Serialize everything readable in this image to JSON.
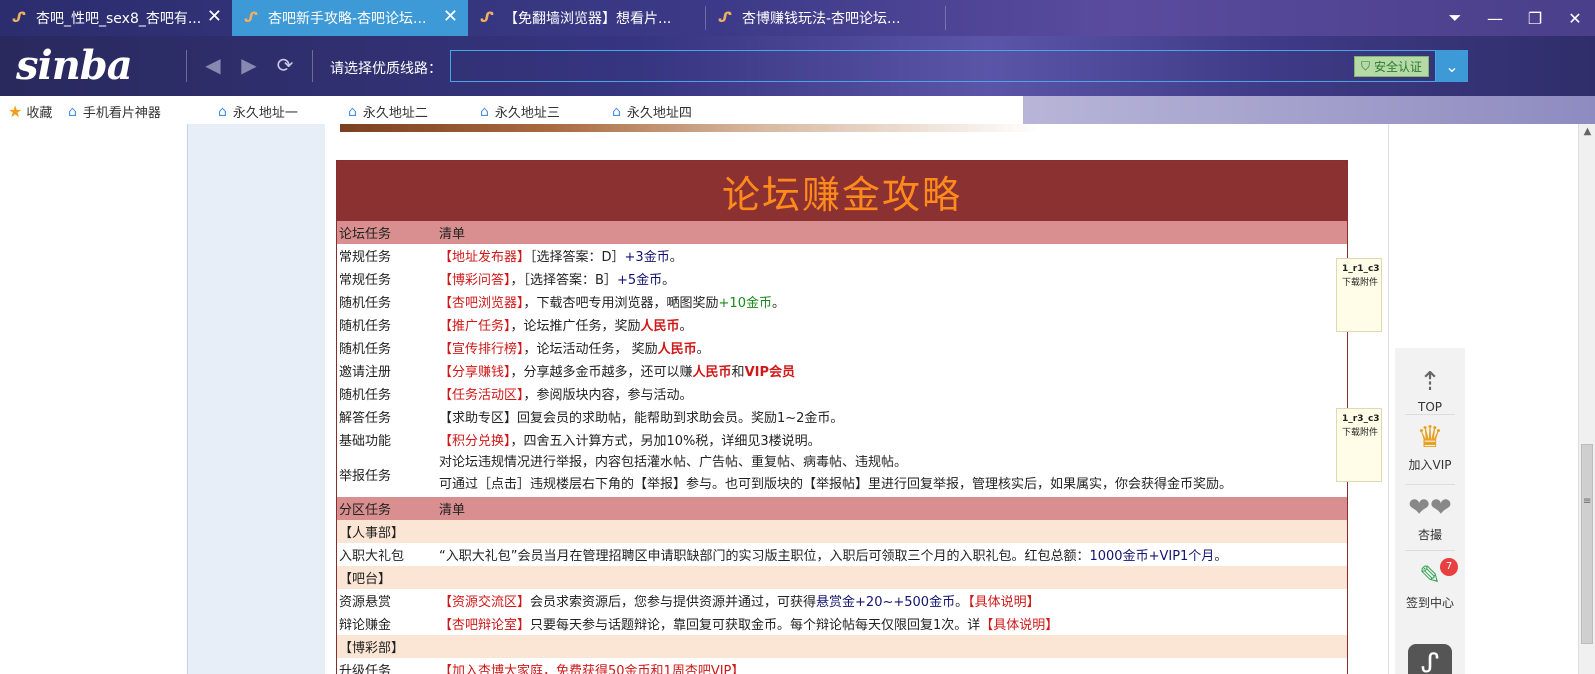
{
  "tabs": [
    {
      "title": "杏吧_性吧_sex8_杏吧有...",
      "close": "✕"
    },
    {
      "title": "杏吧新手攻略-杏吧论坛...",
      "close": "✕"
    },
    {
      "title": "【免翻墙浏览器】想看片...",
      "close": ""
    },
    {
      "title": "杏博赚钱玩法-杏吧论坛...",
      "close": ""
    }
  ],
  "window_controls": {
    "dropdown": "⏷",
    "minimize": "—",
    "maximize": "❐",
    "close": "✕"
  },
  "nav": {
    "logo": "sinba",
    "back": "◀",
    "forward": "▶",
    "refresh": "⟳",
    "route_label": "请选择优质线路：",
    "url_value": "",
    "safe_badge": "安全认证",
    "url_dropdown": "⌄"
  },
  "bookmarks": [
    {
      "label": "收藏"
    },
    {
      "label": "手机看片神器"
    },
    {
      "label": "永久地址一"
    },
    {
      "label": "永久地址二"
    },
    {
      "label": "永久地址三"
    },
    {
      "label": "永久地址四"
    }
  ],
  "table": {
    "title": "论坛赚金攻略",
    "header1": {
      "c1": "论坛任务",
      "c2": "清单"
    },
    "rows": [
      {
        "c1": "常规任务",
        "a": "【地址发布器】",
        "b": "［选择答案：D］",
        "c": "+3金币",
        "d": "。"
      },
      {
        "c1": "常规任务",
        "a": "【博彩问答】",
        "b": "，［选择答案：B］",
        "c": "+5金币",
        "d": "。"
      },
      {
        "c1": "随机任务",
        "a": "【杏吧浏览器】",
        "b": "，下载杏吧专用浏览器，嗮图奖励",
        "c": "+10金币",
        "d": "。"
      },
      {
        "c1": "随机任务",
        "a": "【推广任务】",
        "b": "，论坛推广任务，奖励",
        "c": "人民币",
        "d": "。"
      },
      {
        "c1": "随机任务",
        "a": "【宣传排行榜】",
        "b": "，论坛活动任务， 奖励",
        "c": "人民币",
        "d": "。"
      },
      {
        "c1": "邀请注册",
        "a": "【分享赚钱】",
        "b": "，分享越多金币越多，还可以赚",
        "c": "人民币",
        "d": "和",
        "e": "VIP会员"
      },
      {
        "c1": "随机任务",
        "a": "【任务活动区】",
        "b": "，参阅版块内容，参与活动。",
        "c": "",
        "d": ""
      },
      {
        "c1": "解答任务",
        "a": "",
        "b": "【求助专区】回复会员的求助帖，能帮助到求助会员。奖励1~2金币。",
        "c": "",
        "d": ""
      },
      {
        "c1": "基础功能",
        "a": "【积分兑换】",
        "b": "，四舍五入计算方式，另加10%税，详细见3楼说明。",
        "c": "",
        "d": ""
      }
    ],
    "report": {
      "c1": "举报任务",
      "line1": "对论坛违规情况进行举报，内容包括灌水帖、广告帖、重复帖、病毒帖、违规帖。",
      "line2": "可通过［点击］违规楼层右下角的【举报】参与。也可到版块的【举报帖】里进行回复举报，管理核实后，如果属实，你会获得金币奖励。"
    },
    "header2": {
      "c1": "分区任务",
      "c2": "清单"
    },
    "sec1": "【人事部】",
    "hr_row": {
      "c1": "入职大礼包",
      "b": "“入职大礼包”会员当月在管理招聘区申请职缺部门的实习版主职位，入职后可领取三个月的入职礼包。红包总额：",
      "c": "1000金币+VIP1个月",
      "d": "。"
    },
    "sec2": "【吧台】",
    "res_row": {
      "c1": "资源悬赏",
      "a": "【资源交流区】",
      "b": "会员求索资源后，您参与提供资源并通过，可获得",
      "c": "悬赏金+20~+500金币",
      "d": "。",
      "e": "【具体说明】"
    },
    "debate_row": {
      "c1": "辩论赚金",
      "a": "【杏吧辩论室】",
      "b": "只要每天参与话题辩论，靠回复可获取金币。每个辩论帖每天仅限回复1次。详",
      "e": "【具体说明】"
    },
    "sec3": "【博彩部】",
    "upgrade_row": {
      "c1": "升级任务",
      "a": "【加入杏博大家庭，免费获得50金币和1周杏吧VIP】"
    }
  },
  "notes": [
    {
      "title": "1_r1_c3",
      "text": "下载附件"
    },
    {
      "title": "1_r3_c3",
      "text": "下载附件"
    }
  ],
  "side_panel": {
    "top": "TOP",
    "vip": "加入VIP",
    "xingcuo": "杏撮",
    "checkin": "签到中心",
    "checkin_badge": "7"
  },
  "colors": {
    "accent": "#3d9ad6",
    "table_header": "#8b3131",
    "title_orange": "#ff8a1c",
    "row_header": "#d98f8f",
    "section_bg": "#fbe6d6",
    "highlight_red": "#d01818",
    "navy": "#141470"
  }
}
